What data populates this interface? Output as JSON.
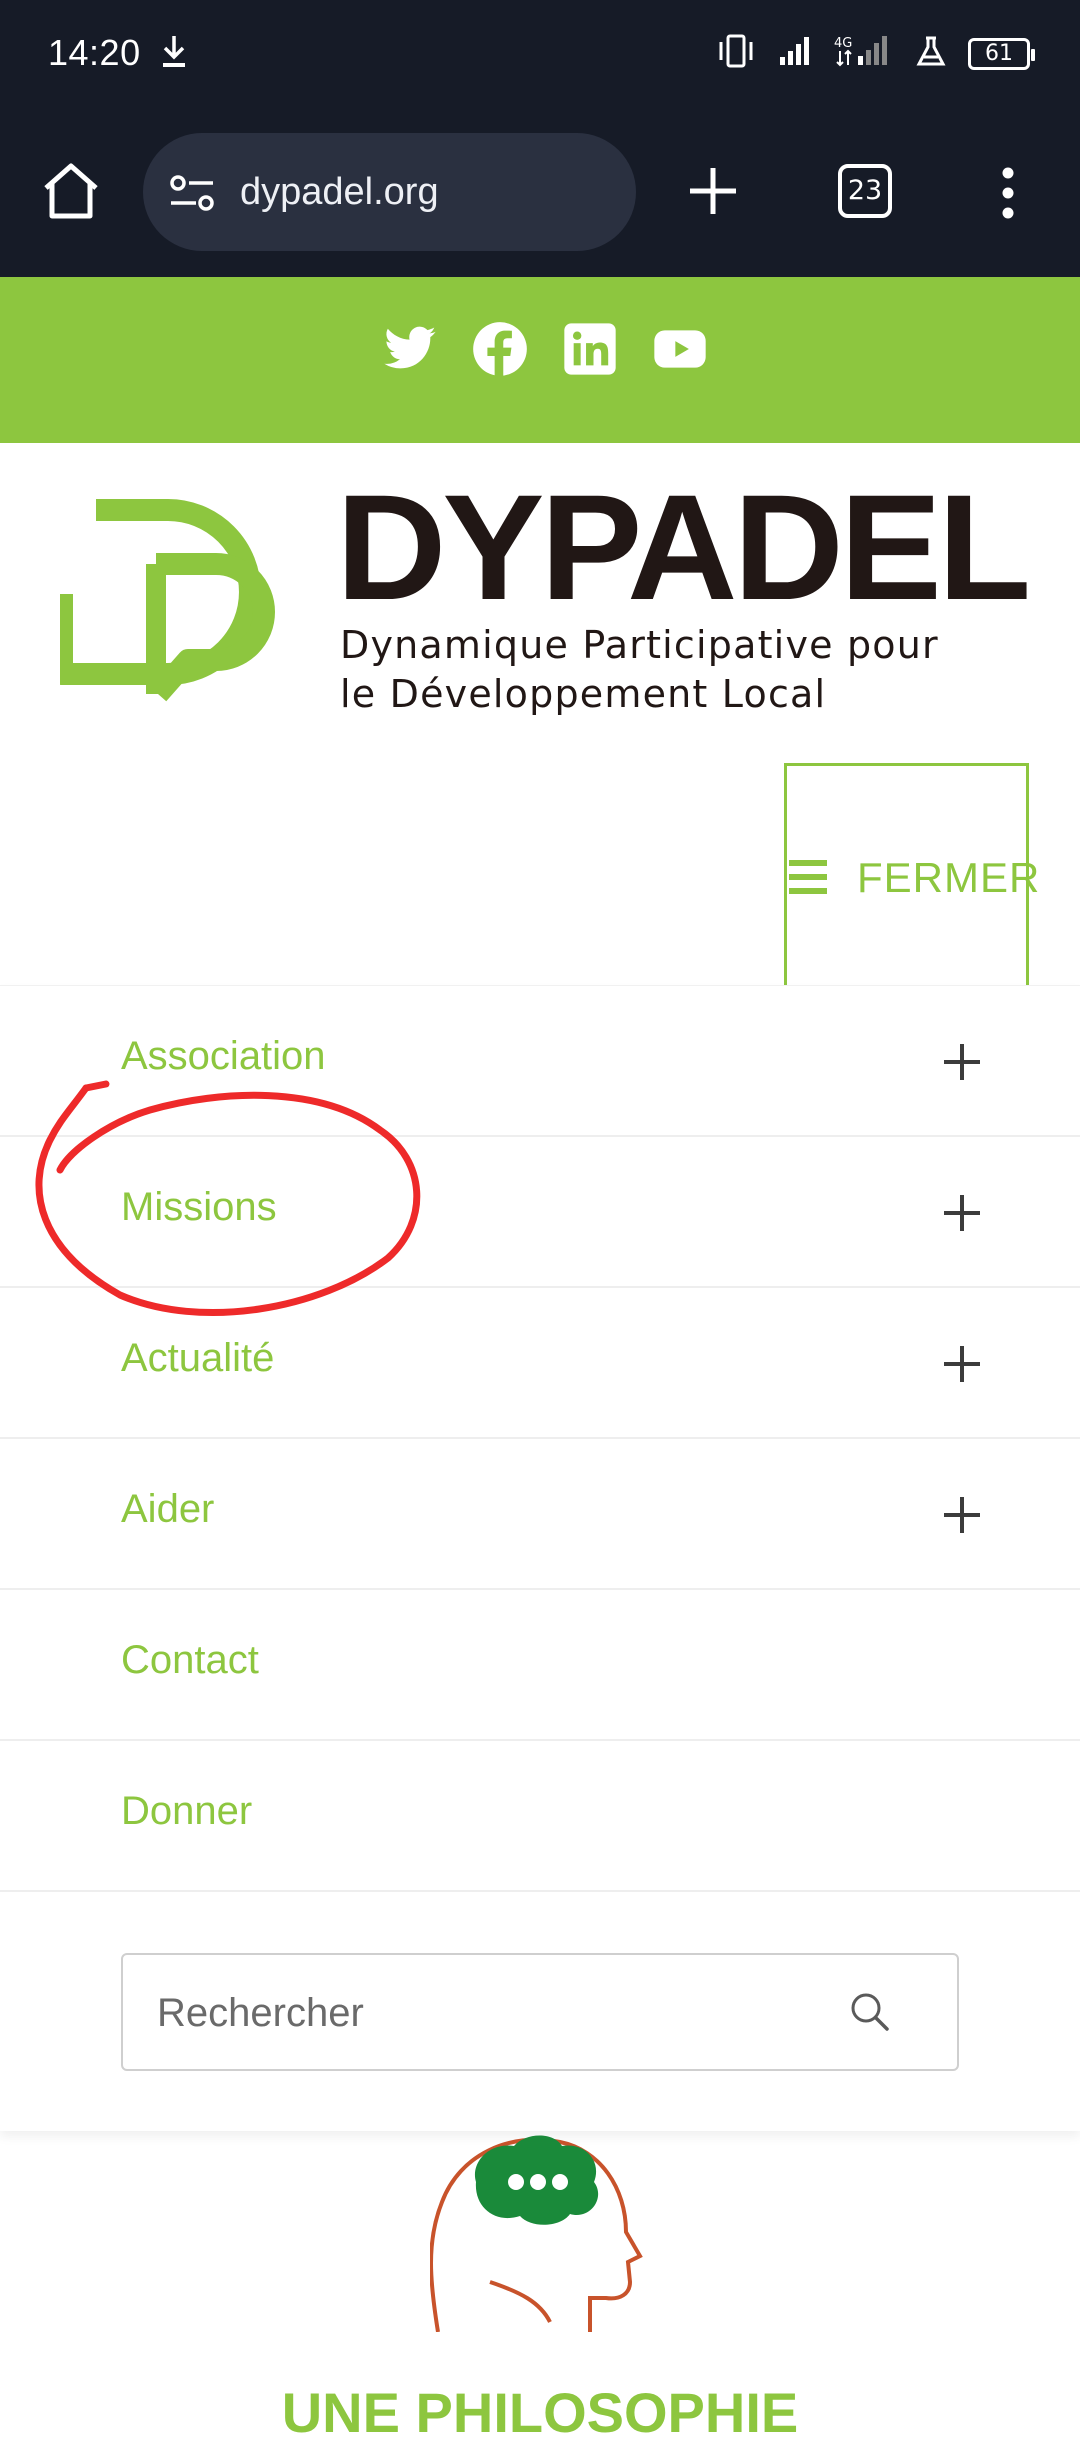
{
  "status_bar": {
    "time": "14:20",
    "battery": "61",
    "network": "4G"
  },
  "browser": {
    "url": "dypadel.org",
    "tab_count": "23"
  },
  "social": [
    "twitter-icon",
    "facebook-icon",
    "linkedin-icon",
    "youtube-icon"
  ],
  "logo": {
    "brand": "DYPADEL",
    "tagline_line1": "Dynamique Participative pour",
    "tagline_line2": "le Développement Local"
  },
  "nav_toggle": {
    "label": "FERMER"
  },
  "menu": {
    "items": [
      {
        "label": "Association",
        "expandable": true
      },
      {
        "label": "Missions",
        "expandable": true
      },
      {
        "label": "Actualité",
        "expandable": true
      },
      {
        "label": "Aider",
        "expandable": true
      },
      {
        "label": "Contact",
        "expandable": false
      },
      {
        "label": "Donner",
        "expandable": false
      }
    ]
  },
  "search": {
    "placeholder": "Rechercher"
  },
  "section": {
    "heading": "UNE PHILOSOPHIE"
  },
  "colors": {
    "brand_green": "#8dc63f",
    "chrome_dark": "#161b27",
    "annotation_red": "#ee2a2a"
  }
}
